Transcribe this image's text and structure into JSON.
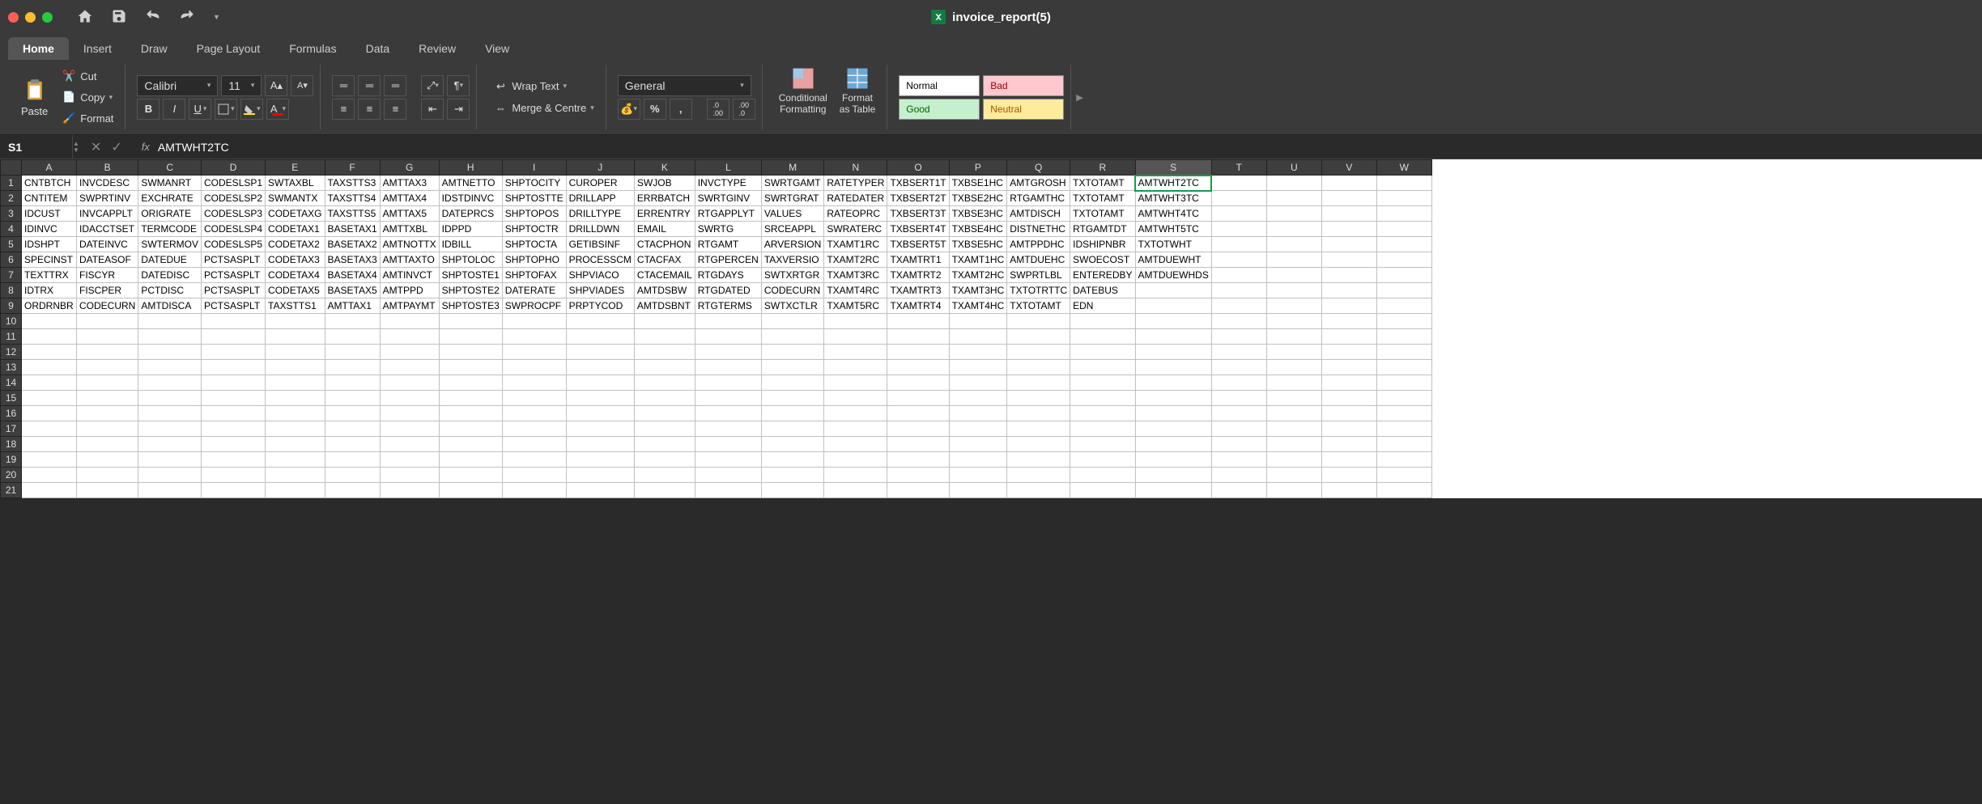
{
  "title": "invoice_report(5)",
  "tabs": [
    "Home",
    "Insert",
    "Draw",
    "Page Layout",
    "Formulas",
    "Data",
    "Review",
    "View"
  ],
  "active_tab": "Home",
  "clipboard": {
    "paste": "Paste",
    "cut": "Cut",
    "copy": "Copy",
    "format": "Format"
  },
  "font": {
    "name": "Calibri",
    "size": "11"
  },
  "alignment": {
    "wrap": "Wrap Text",
    "merge": "Merge & Centre"
  },
  "number_format": "General",
  "fmt_buttons": {
    "conditional": "Conditional\nFormatting",
    "table": "Format\nas Table"
  },
  "styles": {
    "normal": "Normal",
    "bad": "Bad",
    "good": "Good",
    "neutral": "Neutral"
  },
  "name_box": "S1",
  "formula": "AMTWHT2TC",
  "columns": [
    "A",
    "B",
    "C",
    "D",
    "E",
    "F",
    "G",
    "H",
    "I",
    "J",
    "K",
    "L",
    "M",
    "N",
    "O",
    "P",
    "Q",
    "R",
    "S",
    "T",
    "U",
    "V",
    "W"
  ],
  "selected_col": "S",
  "active_cell": {
    "row": 0,
    "col": 18
  },
  "rows": [
    [
      "CNTBTCH",
      "INVCDESC",
      "SWMANRT",
      "CODESLSP1",
      "SWTAXBL",
      "TAXSTTS3",
      "AMTTAX3",
      "AMTNETTO",
      "SHPTOCITY",
      "CUROPER",
      "SWJOB",
      "INVCTYPE",
      "SWRTGAMT",
      "RATETYPER",
      "TXBSERT1T",
      "TXBSE1HC",
      "AMTGROSH",
      "TXTOTAMT",
      "AMTWHT2TC",
      "",
      "",
      "",
      ""
    ],
    [
      "CNTITEM",
      "SWPRTINV",
      "EXCHRATE",
      "CODESLSP2",
      "SWMANTX",
      "TAXSTTS4",
      "AMTTAX4",
      "IDSTDINVC",
      "SHPTOSTTE",
      "DRILLAPP",
      "ERRBATCH",
      "SWRTGINV",
      "SWRTGRAT",
      "RATEDATER",
      "TXBSERT2T",
      "TXBSE2HC",
      "RTGAMTHC",
      "TXTOTAMT",
      "AMTWHT3TC",
      "",
      "",
      "",
      ""
    ],
    [
      "IDCUST",
      "INVCAPPLT",
      "ORIGRATE",
      "CODESLSP3",
      "CODETAXG",
      "TAXSTTS5",
      "AMTTAX5",
      "DATEPRCS",
      "SHPTOPOS",
      "DRILLTYPE",
      "ERRENTRY",
      "RTGAPPLYT",
      "VALUES",
      "RATEOPRC",
      "TXBSERT3T",
      "TXBSE3HC",
      "AMTDISCH",
      "TXTOTAMT",
      "AMTWHT4TC",
      "",
      "",
      "",
      ""
    ],
    [
      "IDINVC",
      "IDACCTSET",
      "TERMCODE",
      "CODESLSP4",
      "CODETAX1",
      "BASETAX1",
      "AMTTXBL",
      "IDPPD",
      "SHPTOCTR",
      "DRILLDWN",
      "EMAIL",
      "SWRTG",
      "SRCEAPPL",
      "SWRATERC",
      "TXBSERT4T",
      "TXBSE4HC",
      "DISTNETHC",
      "RTGAMTDT",
      "AMTWHT5TC",
      "",
      "",
      "",
      ""
    ],
    [
      "IDSHPT",
      "DATEINVC",
      "SWTERMOV",
      "CODESLSP5",
      "CODETAX2",
      "BASETAX2",
      "AMTNOTTX",
      "IDBILL",
      "SHPTOCTA",
      "GETIBSINF",
      "CTACPHON",
      "RTGAMT",
      "ARVERSION",
      "TXAMT1RC",
      "TXBSERT5T",
      "TXBSE5HC",
      "AMTPPDHC",
      "IDSHIPNBR",
      "TXTOTWHT",
      "",
      "",
      "",
      ""
    ],
    [
      "SPECINST",
      "DATEASOF",
      "DATEDUE",
      "PCTSASPLT",
      "CODETAX3",
      "BASETAX3",
      "AMTTAXTO",
      "SHPTOLOC",
      "SHPTOPHO",
      "PROCESSCM",
      "CTACFAX",
      "RTGPERCEN",
      "TAXVERSIO",
      "TXAMT2RC",
      "TXAMTRT1",
      "TXAMT1HC",
      "AMTDUEHC",
      "SWOECOST",
      "AMTDUEWHT",
      "",
      "",
      "",
      ""
    ],
    [
      "TEXTTRX",
      "FISCYR",
      "DATEDISC",
      "PCTSASPLT",
      "CODETAX4",
      "BASETAX4",
      "AMTINVCT",
      "SHPTOSTE1",
      "SHPTOFAX",
      "SHPVIACO",
      "CTACEMAIL",
      "RTGDAYS",
      "SWTXRTGR",
      "TXAMT3RC",
      "TXAMTRT2",
      "TXAMT2HC",
      "SWPRTLBL",
      "ENTEREDBY",
      "AMTDUEWHDS",
      "",
      "",
      "",
      ""
    ],
    [
      "IDTRX",
      "FISCPER",
      "PCTDISC",
      "PCTSASPLT",
      "CODETAX5",
      "BASETAX5",
      "AMTPPD",
      "SHPTOSTE2",
      "DATERATE",
      "SHPVIADES",
      "AMTDSBW",
      "RTGDATED",
      "CODECURN",
      "TXAMT4RC",
      "TXAMTRT3",
      "TXAMT3HC",
      "TXTOTRTTC",
      "DATEBUS",
      "",
      "",
      "",
      "",
      ""
    ],
    [
      "ORDRNBR",
      "CODECURN",
      "AMTDISCA",
      "PCTSASPLT",
      "TAXSTTS1",
      "AMTTAX1",
      "AMTPAYMT",
      "SHPTOSTE3",
      "SWPROCPF",
      "PRPTYCOD",
      "AMTDSBNT",
      "RTGTERMS",
      "SWTXCTLR",
      "TXAMT5RC",
      "TXAMTRT4",
      "TXAMT4HC",
      "TXTOTAMT",
      "EDN",
      "",
      "",
      "",
      "",
      ""
    ]
  ],
  "empty_rows": 12
}
